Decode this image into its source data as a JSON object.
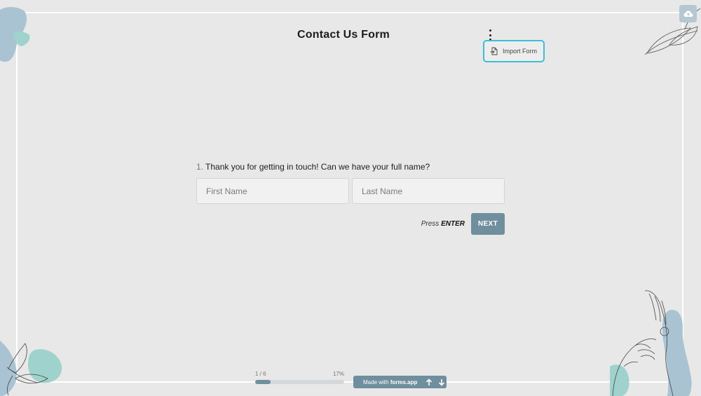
{
  "form": {
    "title": "Contact Us Form"
  },
  "menu": {
    "import_label": "Import Form"
  },
  "question": {
    "number": "1.",
    "text": "Thank you for getting in touch! Can we have your full name?",
    "first_name_placeholder": "First Name",
    "last_name_placeholder": "Last Name",
    "first_name_value": "",
    "last_name_value": ""
  },
  "actions": {
    "press_prefix": "Press",
    "press_key": "ENTER",
    "next_label": "NEXT"
  },
  "progress": {
    "count": "1 / 6",
    "percent_label": "17%",
    "fraction": 0.17
  },
  "footer": {
    "made_with": "Made with",
    "brand": "forms.app"
  },
  "colors": {
    "background": "#e8e8e8",
    "accent": "#6f8e9e",
    "highlight_border": "#3cbfd6"
  },
  "icons": {
    "upload": "cloud-upload-icon",
    "menu": "kebab-menu-icon",
    "import": "import-file-icon",
    "up": "arrow-up-icon",
    "down": "arrow-down-icon"
  }
}
